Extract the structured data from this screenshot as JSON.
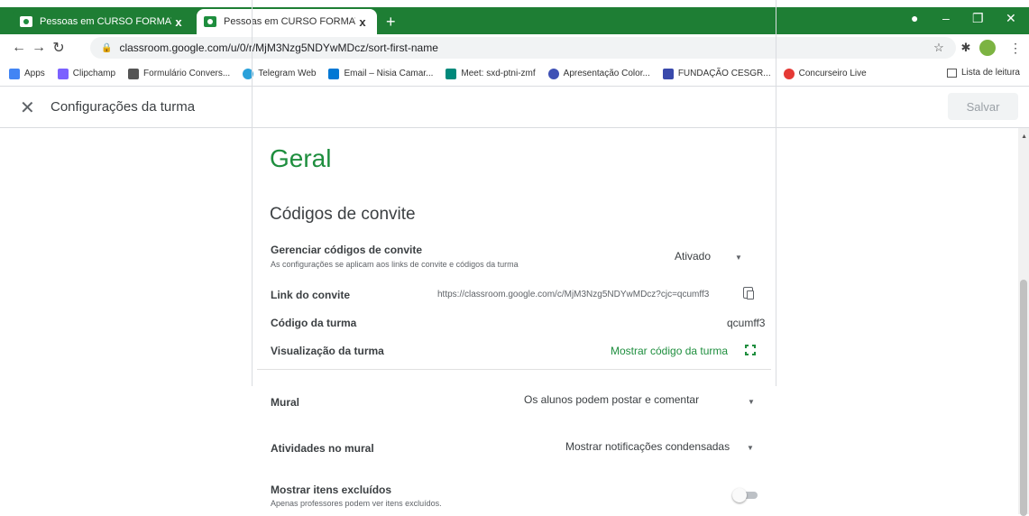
{
  "browser": {
    "tabs": [
      {
        "title": "Pessoas em CURSO FORMATIVO",
        "close": "x"
      },
      {
        "title": "Pessoas em CURSO FORMATIVO",
        "close": "x"
      }
    ],
    "new_tab": "+",
    "url": "classroom.google.com/u/0/r/MjM3Nzg5NDYwMDcz/sort-first-name",
    "bookmarks": [
      {
        "label": "Apps",
        "color": "#4285f4"
      },
      {
        "label": "Clipchamp",
        "color": "#7b61ff"
      },
      {
        "label": "Formulário Convers...",
        "color": "#555555"
      },
      {
        "label": "Telegram Web",
        "color": "#2aa1da"
      },
      {
        "label": "Email – Nisia Camar...",
        "color": "#0078d4"
      },
      {
        "label": "Meet: sxd-ptni-zmf",
        "color": "#00897b"
      },
      {
        "label": "Apresentação Color...",
        "color": "#3f51b5"
      },
      {
        "label": "FUNDAÇÃO CESGR...",
        "color": "#3949ab"
      },
      {
        "label": "Concurseiro Live",
        "color": "#e53935"
      }
    ],
    "reading_list": "Lista de leitura"
  },
  "header": {
    "title": "Configurações da turma",
    "save_label": "Salvar"
  },
  "main": {
    "section_title": "Geral",
    "subsection_title": "Códigos de convite",
    "manage_codes": {
      "label": "Gerenciar códigos de convite",
      "description": "As configurações se aplicam aos links de convite e códigos da turma",
      "value": "Ativado"
    },
    "invite_link": {
      "label": "Link do convite",
      "value": "https://classroom.google.com/c/MjM3Nzg5NDYwMDcz?cjc=qcumff3"
    },
    "class_code": {
      "label": "Código da turma",
      "value": "qcumff3"
    },
    "class_view": {
      "label": "Visualização da turma",
      "value": "Mostrar código da turma"
    },
    "stream": {
      "label": "Mural",
      "value": "Os alunos podem postar e comentar"
    },
    "stream_activities": {
      "label": "Atividades no mural",
      "value": "Mostrar notificações condensadas"
    },
    "deleted_items": {
      "label": "Mostrar itens excluídos",
      "description": "Apenas professores podem ver itens excluídos.",
      "enabled": false
    }
  }
}
